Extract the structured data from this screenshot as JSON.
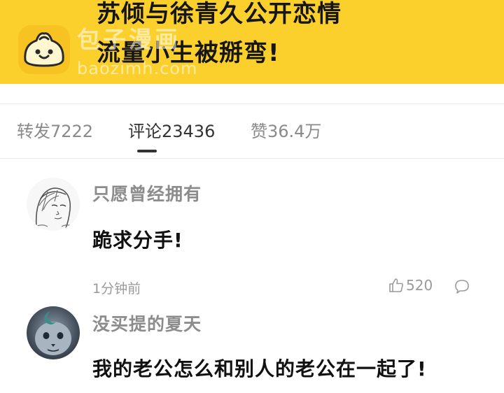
{
  "banner": {
    "headline_line1": "苏倾与徐青久公开恋情",
    "headline_line2": "流量小生被掰弯!",
    "watermark_text": "包子漫画",
    "watermark_url": "baozimh.com",
    "color": "#fbd02d"
  },
  "tabs": [
    {
      "label": "转发7222",
      "active": false
    },
    {
      "label": "评论23436",
      "active": true
    },
    {
      "label": "赞36.4万",
      "active": false
    }
  ],
  "comments": [
    {
      "username": "只愿曾经拥有",
      "content": "跪求分手!",
      "time": "1分钟前",
      "likes": "520",
      "avatar_icon": "sketch-portrait-avatar"
    },
    {
      "username": "没买提的夏天",
      "content": "我的老公怎么和别人的老公在一起了!",
      "avatar_icon": "moon-cat-avatar"
    }
  ]
}
